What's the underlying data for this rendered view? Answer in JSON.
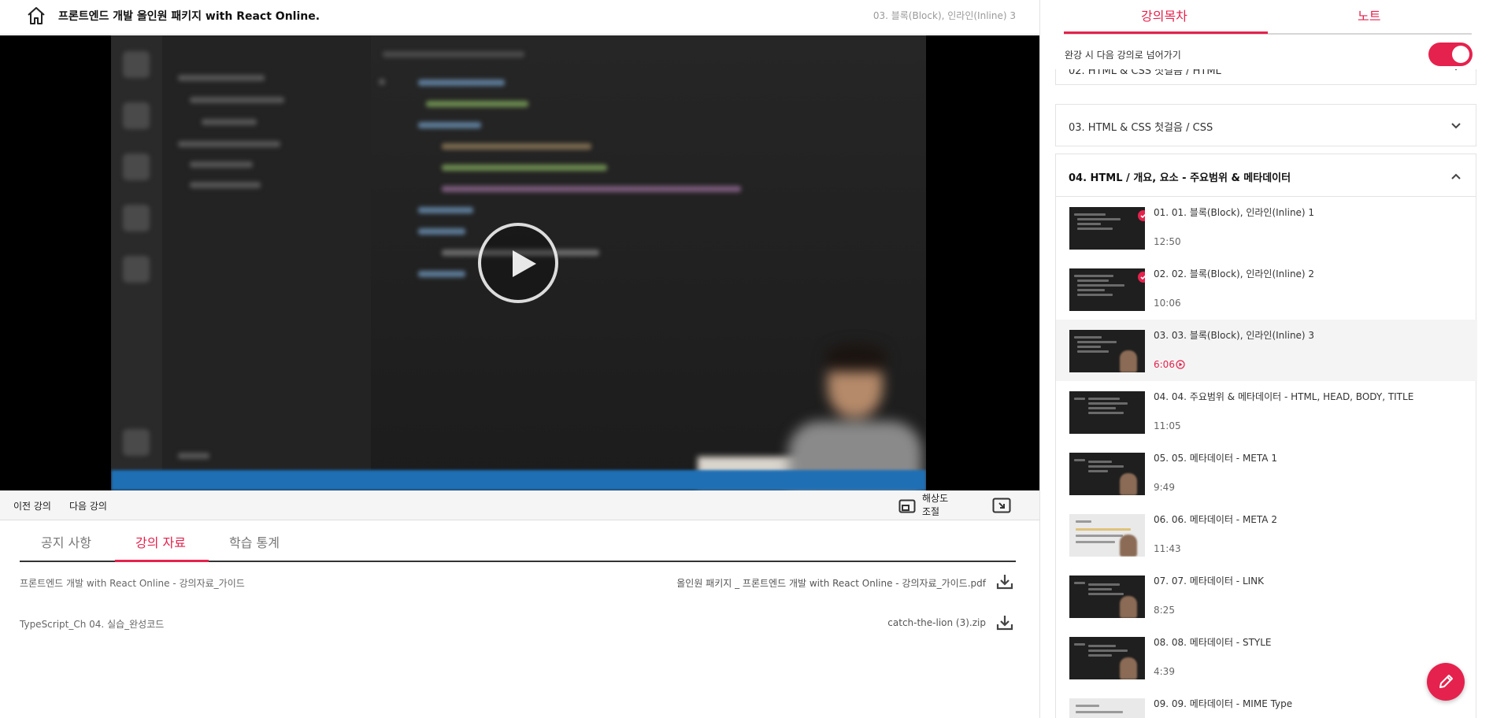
{
  "header": {
    "course_title": "프론트엔드 개발 올인원 패키지 with React Online.",
    "current_lesson": "03. 블록(Block), 인라인(Inline) 3",
    "home_icon": "home-icon"
  },
  "player": {
    "play_icon": "play-icon"
  },
  "controls": {
    "prev_label": "이전 강의",
    "next_label": "다음 강의",
    "resolution_label": "해상도 조절",
    "resolution_icon": "picture-in-picture-icon",
    "wide_icon": "wide-mode-icon"
  },
  "tabs": [
    {
      "label": "공지 사항",
      "active": false
    },
    {
      "label": "강의 자료",
      "active": true
    },
    {
      "label": "학습 통계",
      "active": false
    }
  ],
  "materials": [
    {
      "name": "프론트엔드 개발 with React Online - 강의자료_가이드",
      "file": "올인원 패키지 _ 프론트엔드 개발 with React Online - 강의자료_가이드.pdf"
    },
    {
      "name": "TypeScript_Ch 04. 실습_완성코드",
      "file": "catch-the-lion (3).zip"
    }
  ],
  "sidebar": {
    "tabs": [
      {
        "label": "강의목차",
        "active": true
      },
      {
        "label": "노트",
        "active": false
      }
    ],
    "autoplay_label": "완강 시 다음 강의로 넘어가기",
    "autoplay_on": true,
    "sections": [
      {
        "title": "02. HTML & CSS 첫걸음 / HTML",
        "expanded": false
      },
      {
        "title": "03. HTML & CSS 첫걸음 / CSS",
        "expanded": false
      },
      {
        "title": "04. HTML / 개요, 요소 - 주요범위 & 메타데이터",
        "expanded": true
      }
    ],
    "lessons": [
      {
        "title": "01. 01. 블록(Block), 인라인(Inline) 1",
        "duration": "12:50",
        "completed": true,
        "playing": false
      },
      {
        "title": "02. 02. 블록(Block), 인라인(Inline) 2",
        "duration": "10:06",
        "completed": true,
        "playing": false
      },
      {
        "title": "03. 03. 블록(Block), 인라인(Inline) 3",
        "duration": "6:06",
        "completed": false,
        "playing": true
      },
      {
        "title": "04. 04. 주요범위 & 메타데이터 - HTML, HEAD, BODY, TITLE",
        "duration": "11:05",
        "completed": false,
        "playing": false
      },
      {
        "title": "05. 05. 메타데이터 - META 1",
        "duration": "9:49",
        "completed": false,
        "playing": false
      },
      {
        "title": "06. 06. 메타데이터 - META 2",
        "duration": "11:43",
        "completed": false,
        "playing": false
      },
      {
        "title": "07. 07. 메타데이터 - LINK",
        "duration": "8:25",
        "completed": false,
        "playing": false
      },
      {
        "title": "08. 08. 메타데이터 - STYLE",
        "duration": "4:39",
        "completed": false,
        "playing": false
      },
      {
        "title": "09. 09. 메타데이터 - MIME Type",
        "duration": "",
        "completed": false,
        "playing": false
      }
    ]
  },
  "fab": {
    "icon": "pencil-icon"
  },
  "colors": {
    "accent": "#e5224d",
    "text": "#222222",
    "muted": "#777777"
  }
}
